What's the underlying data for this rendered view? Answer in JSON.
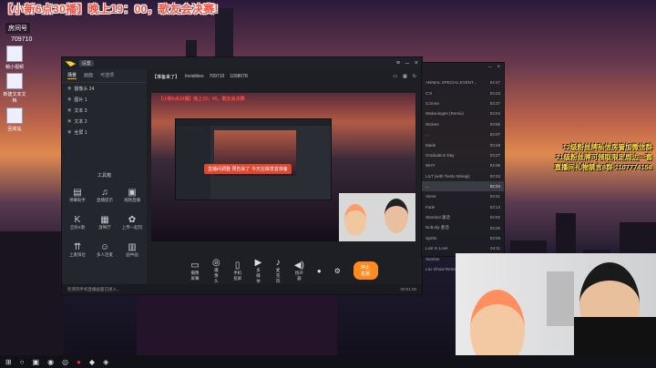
{
  "banner": "【小新6点30播】晚上19：00，歌友会决赛!",
  "room": {
    "label": "房间号",
    "number": "709710"
  },
  "desktop_icons": [
    "萌小视频",
    "新建文本文档",
    "回收站"
  ],
  "app": {
    "title_btn": "设置",
    "tabs": [
      "场景",
      "画面",
      "可选项"
    ],
    "scenes": [
      "摄像头 24",
      "图片 1",
      "文本 3",
      "文本 2",
      "全屏 1"
    ],
    "toolbox_title": "工具箱",
    "tools": [
      "弹幕助手",
      "直播提示",
      "视频直播",
      "全民K歌",
      "放映厅",
      "上传一起玩",
      "上麦排位",
      "多人连麦",
      "画中画"
    ],
    "room_title": "【准备来了】",
    "viewer_label": "Invisibles",
    "room_id": "709710",
    "fans": "1098078",
    "overlay_line": "【小新6点30播】晚上19：00，歌友会决赛",
    "notice_a": "直播间调整",
    "notice_b": "预告来了",
    "notice_c": "今天在做发音准备",
    "controls": [
      "摄像屏幕",
      "摄像头",
      "手机投屏",
      "多媒体",
      "麦克风",
      "扬声器"
    ],
    "go_live": "停止直播",
    "status_tip": "检测到手机直播画面已接入...",
    "time": "00:01:00"
  },
  "playlist": [
    {
      "t": "ANIMAL SPECIAL EVENT...",
      "d": "04:47"
    },
    {
      "t": "C'S",
      "d": "03:23"
    },
    {
      "t": "Corona",
      "d": "03:37"
    },
    {
      "t": "Wakuningen (Remix)",
      "d": "04:04"
    },
    {
      "t": "Wolves",
      "d": "03:56"
    },
    {
      "t": "...",
      "d": "04:07"
    },
    {
      "t": "Made",
      "d": "03:48"
    },
    {
      "t": "Graduation Day",
      "d": "03:27"
    },
    {
      "t": "WHY",
      "d": "04:06"
    },
    {
      "t": "LILT (with Tiesto Minagi)",
      "d": "03:33"
    },
    {
      "t": "...",
      "d": "02:24"
    },
    {
      "t": "Alone",
      "d": "03:21"
    },
    {
      "t": "Fade",
      "d": "03:13"
    },
    {
      "t": "Stardust 童话",
      "d": "04:02"
    },
    {
      "t": "Nobody 童话",
      "d": "03:25"
    },
    {
      "t": "Spirits",
      "d": "03:08"
    },
    {
      "t": "Lost In Love",
      "d": "04:11"
    },
    {
      "t": "Sunrise",
      "d": "04:05"
    },
    {
      "t": "LILI Ghost Remix",
      "d": "03:48"
    }
  ],
  "marquee": {
    "l1": "12级粉丝牌私信房管加微信群",
    "l2": "21级粉丝牌可领取限定周边一套",
    "l3": "直播间礼物禁言8群 1107774158"
  }
}
